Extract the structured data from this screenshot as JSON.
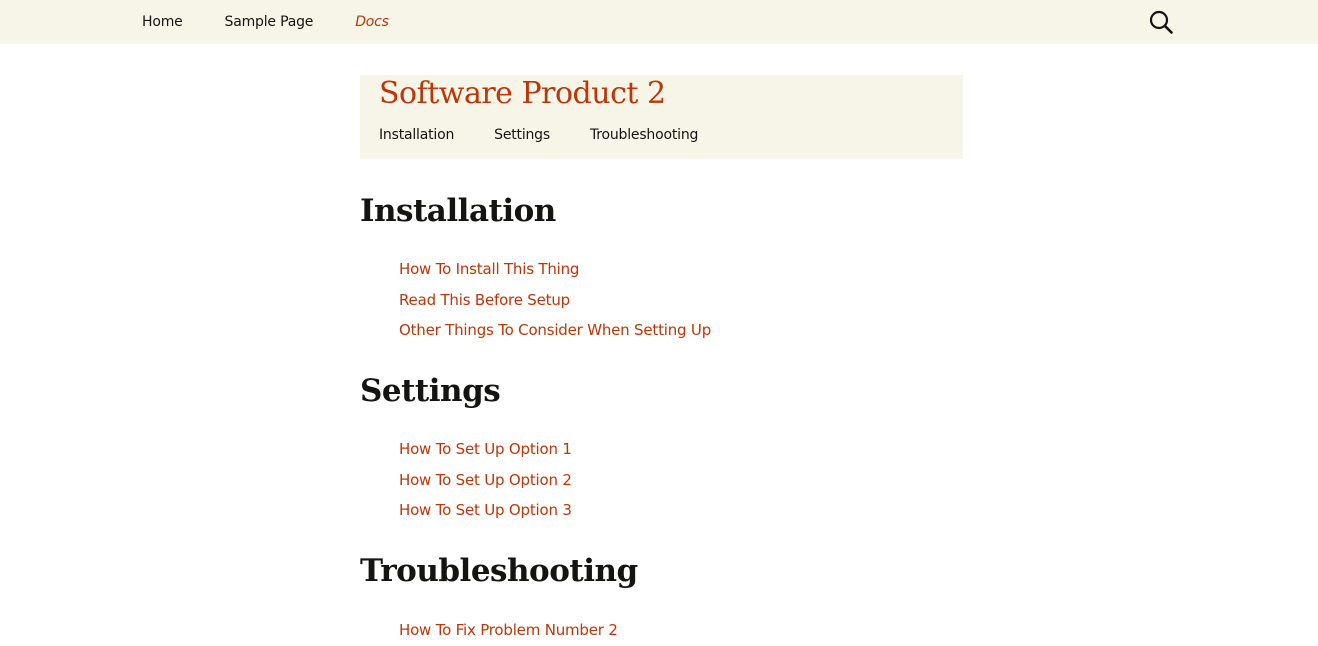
{
  "top_nav": {
    "items": [
      {
        "label": "Home",
        "current": false
      },
      {
        "label": "Sample Page",
        "current": false
      },
      {
        "label": "Docs",
        "current": true
      }
    ],
    "search_icon": "search-icon"
  },
  "product": {
    "title": "Software Product 2",
    "subnav": [
      "Installation",
      "Settings",
      "Troubleshooting"
    ]
  },
  "sections": [
    {
      "heading": "Installation",
      "links": [
        "How To Install This Thing",
        "Read This Before Setup",
        "Other Things To Consider When Setting Up"
      ]
    },
    {
      "heading": "Settings",
      "links": [
        "How To Set Up Option 1",
        "How To Set Up Option 2",
        "How To Set Up Option 3"
      ]
    },
    {
      "heading": "Troubleshooting",
      "links": [
        "How To Fix Problem Number 2"
      ]
    }
  ],
  "colors": {
    "accent": "#bc360a",
    "header_bg": "#f7f5e7",
    "text": "#141412"
  }
}
